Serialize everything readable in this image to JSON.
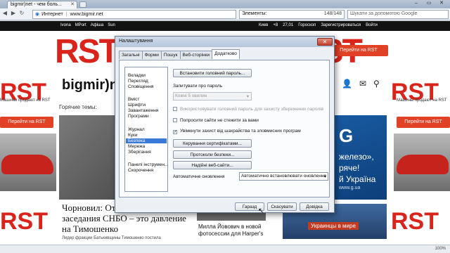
{
  "browser": {
    "tab_title": "bigmir)net - чем боль...",
    "address_zone": "Интернет",
    "address_url": "www.bigmir.net",
    "find_label": "Элементы:",
    "find_count": "148/148",
    "search_placeholder": "Шукати за допомогою Google",
    "zoom": "100%"
  },
  "site": {
    "top_links": [
      "Ivona",
      "MPort",
      "Афіша",
      "Sun"
    ],
    "weather_city": "Киев",
    "weather_temp": "+8",
    "currency": "27,01",
    "horoscope": "Гороскоп",
    "register": "Зарегистрироваться",
    "login": "Войти",
    "brand": "bigmir)net",
    "ad_rst": "RST",
    "ad_caption": "Машины продают на RST",
    "ad_button": "Перейти на RST",
    "hot_topics": "Горячие темы:",
    "headline": "Чорновил: От стенограммы заседания СНБО – это давление на Тимошенко",
    "sub": "Лидер фракции Батькивщины Тимошенко постила",
    "milla": "Милла Йовович в новой фотосессии для Harper's",
    "blue_ad": [
      "G",
      "железо»,",
      "ряче!",
      "й Україна"
    ],
    "blue_ad_small": "www.g.ua",
    "ukr_ad": "Украинцы в мире"
  },
  "dialog": {
    "title": "Налаштування",
    "tabs": [
      "Загальні",
      "Форми",
      "Пошук",
      "Веб-сторінки",
      "Додатково"
    ],
    "active_tab": "Додатково",
    "categories": [
      "Вкладки",
      "Перегляд",
      "Сповіщення",
      "Вміст",
      "Шрифти",
      "Завантаження",
      "Програми",
      "Журнал",
      "Куки",
      "Безпека",
      "Мережа",
      "Зберігання",
      "Панелі інструмен...",
      "Скорочення"
    ],
    "selected_category": "Безпека",
    "master_password_button": "Встановити головний пароль...",
    "ask_password_label": "Запитувати про пароль",
    "ask_password_value": "Кожні 5 хвилин",
    "chk_use_master": "Використовувати головний пароль для захисту збережених паролів",
    "chk_dont_track": "Попросити сайти не стежити за вами",
    "chk_fraud": "Увімкнути захист від шахрайства та зловмисних програм",
    "cert_button": "Керування сертифікатами...",
    "protocols_button": "Протоколи безпеки...",
    "trusted_sites_button": "Надійні веб-сайти...",
    "auto_update_label": "Автоматичне оновлення",
    "auto_update_value": "Автоматично встановлювати оновлення",
    "ok_button": "Гаразд",
    "cancel_button": "Скасувати",
    "help_button": "Довідка"
  }
}
